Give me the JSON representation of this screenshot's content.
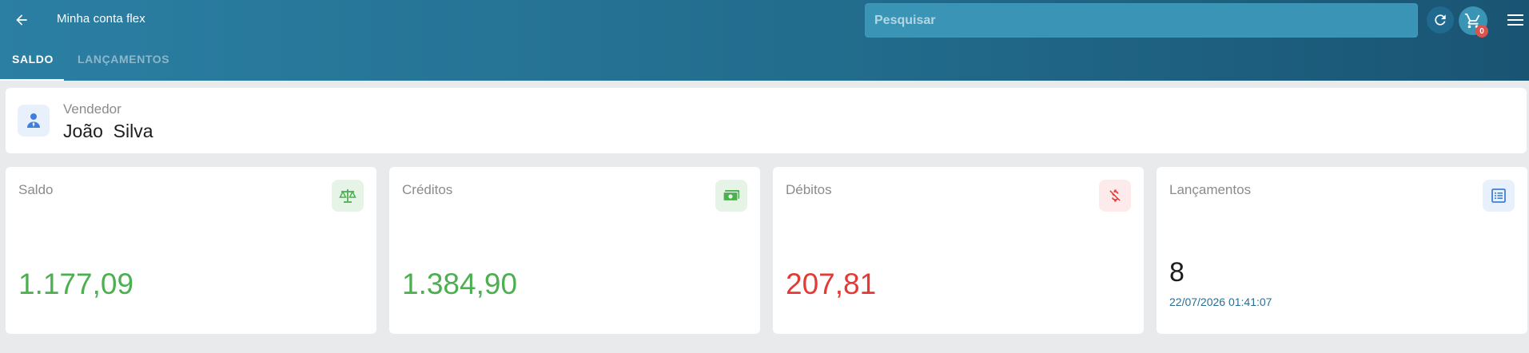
{
  "header": {
    "title": "Minha conta flex",
    "search_placeholder": "Pesquisar",
    "cart_count": "0",
    "icons": {
      "back": "arrow-left-icon",
      "refresh": "refresh-icon",
      "cart": "cart-icon",
      "menu": "menu-icon"
    }
  },
  "tabs": [
    {
      "label": "SALDO",
      "active": true
    },
    {
      "label": "LANÇAMENTOS",
      "active": false
    }
  ],
  "seller": {
    "label": "Vendedor",
    "name": "João  Silva",
    "icon": "person-icon"
  },
  "stats": {
    "saldo": {
      "label": "Saldo",
      "value": "1.177,09",
      "icon": "scale-icon",
      "color": "#4caf50"
    },
    "creditos": {
      "label": "Créditos",
      "value": "1.384,90",
      "icon": "money-icon",
      "color": "#4caf50"
    },
    "debitos": {
      "label": "Débitos",
      "value": "207,81",
      "icon": "no-money-icon",
      "color": "#e53935"
    },
    "lancamentos": {
      "label": "Lançamentos",
      "value": "8",
      "date": "22/07/2026 01:41:07",
      "icon": "list-icon",
      "color": "#1d1d1d"
    }
  },
  "colors": {
    "header_start": "#2b7fa3",
    "header_end": "#1a5473",
    "positive": "#4caf50",
    "negative": "#e53935"
  }
}
